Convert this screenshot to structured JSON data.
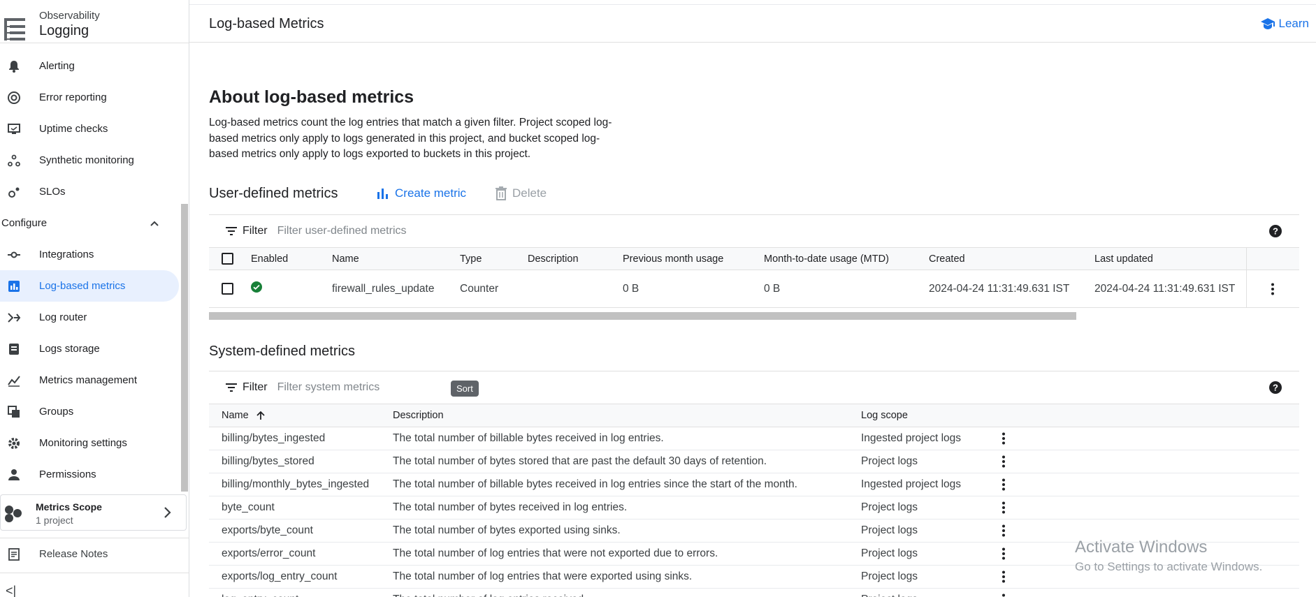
{
  "app": {
    "product_sup": "Observability",
    "product_name": "Logging"
  },
  "header": {
    "title": "Log-based Metrics",
    "learn_label": "Learn"
  },
  "sidebar": {
    "items": [
      {
        "label": "Alerting",
        "icon": "bell-icon"
      },
      {
        "label": "Error reporting",
        "icon": "error-reporting-icon"
      },
      {
        "label": "Uptime checks",
        "icon": "monitor-icon"
      },
      {
        "label": "Synthetic monitoring",
        "icon": "synthetic-icon"
      },
      {
        "label": "SLOs",
        "icon": "slo-icon"
      }
    ],
    "section_label": "Configure",
    "config_items": [
      {
        "label": "Integrations",
        "icon": "integrations-icon"
      },
      {
        "label": "Log-based metrics",
        "icon": "log-metrics-icon",
        "active": true
      },
      {
        "label": "Log router",
        "icon": "router-icon"
      },
      {
        "label": "Logs storage",
        "icon": "storage-icon"
      },
      {
        "label": "Metrics management",
        "icon": "metrics-icon"
      },
      {
        "label": "Groups",
        "icon": "groups-icon"
      },
      {
        "label": "Monitoring settings",
        "icon": "gear-icon"
      },
      {
        "label": "Permissions",
        "icon": "person-icon"
      }
    ],
    "scope_title": "Metrics Scope",
    "scope_sub": "1 project",
    "release_notes": "Release Notes",
    "collapse_glyph": "<|"
  },
  "about": {
    "title": "About log-based metrics",
    "text": "Log-based metrics count the log entries that match a given filter. Project scoped log-based metrics only apply to logs generated in this project, and bucket scoped log-based metrics only apply to logs exported to buckets in this project."
  },
  "user_defined": {
    "title": "User-defined metrics",
    "create_label": "Create metric",
    "delete_label": "Delete",
    "filter_label": "Filter",
    "filter_placeholder": "Filter user-defined metrics",
    "columns": [
      "Enabled",
      "Name",
      "Type",
      "Description",
      "Previous month usage",
      "Month-to-date usage (MTD)",
      "Created",
      "Last updated"
    ],
    "rows": [
      {
        "enabled": true,
        "name": "firewall_rules_update",
        "type": "Counter",
        "description": "",
        "prev_usage": "0 B",
        "mtd_usage": "0 B",
        "created": "2024-04-24 11:31:49.631 IST",
        "updated": "2024-04-24 11:31:49.631 IST"
      }
    ]
  },
  "system_defined": {
    "title": "System-defined metrics",
    "filter_label": "Filter",
    "filter_placeholder": "Filter system metrics",
    "sort_tooltip": "Sort",
    "columns": [
      "Name",
      "Description",
      "Log scope"
    ],
    "rows": [
      {
        "name": "billing/bytes_ingested",
        "description": "The total number of billable bytes received in log entries.",
        "scope": "Ingested project logs"
      },
      {
        "name": "billing/bytes_stored",
        "description": "The total number of bytes stored that are past the default 30 days of retention.",
        "scope": "Project logs"
      },
      {
        "name": "billing/monthly_bytes_ingested",
        "description": "The total number of billable bytes received in log entries since the start of the month.",
        "scope": "Ingested project logs"
      },
      {
        "name": "byte_count",
        "description": "The total number of bytes received in log entries.",
        "scope": "Project logs"
      },
      {
        "name": "exports/byte_count",
        "description": "The total number of bytes exported using sinks.",
        "scope": "Project logs"
      },
      {
        "name": "exports/error_count",
        "description": "The total number of log entries that were not exported due to errors.",
        "scope": "Project logs"
      },
      {
        "name": "exports/log_entry_count",
        "description": "The total number of log entries that were exported using sinks.",
        "scope": "Project logs"
      },
      {
        "name": "log_entry_count",
        "description": "The total number of log entries received.",
        "scope": "Project logs"
      }
    ]
  },
  "watermark": {
    "line1": "Activate Windows",
    "line2": "Go to Settings to activate Windows."
  },
  "colors": {
    "accent": "#1a73e8",
    "enabled_green": "#188038",
    "active_bg": "#e8f0fe"
  }
}
